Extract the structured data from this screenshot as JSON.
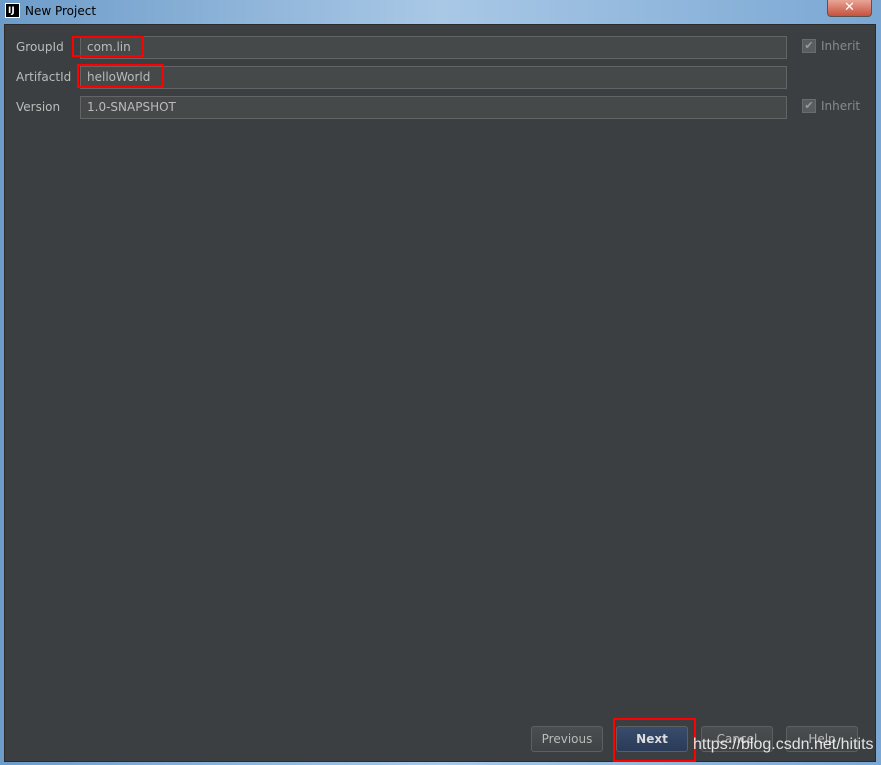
{
  "window": {
    "title": "New Project",
    "app_icon": "IJ",
    "close_icon": "close-icon"
  },
  "form": {
    "group_id": {
      "label": "GroupId",
      "value": "com.lin",
      "inherit_label": "Inherit",
      "inherit_checked": true
    },
    "artifact_id": {
      "label": "ArtifactId",
      "value": "helloWorld"
    },
    "version": {
      "label": "Version",
      "value": "1.0-SNAPSHOT",
      "inherit_label": "Inherit",
      "inherit_checked": true
    }
  },
  "buttons": {
    "previous": "Previous",
    "next": "Next",
    "cancel": "Cancel",
    "help": "Help"
  },
  "highlight_color": "#ff0000",
  "watermark": "https://blog.csdn.net/hitits"
}
